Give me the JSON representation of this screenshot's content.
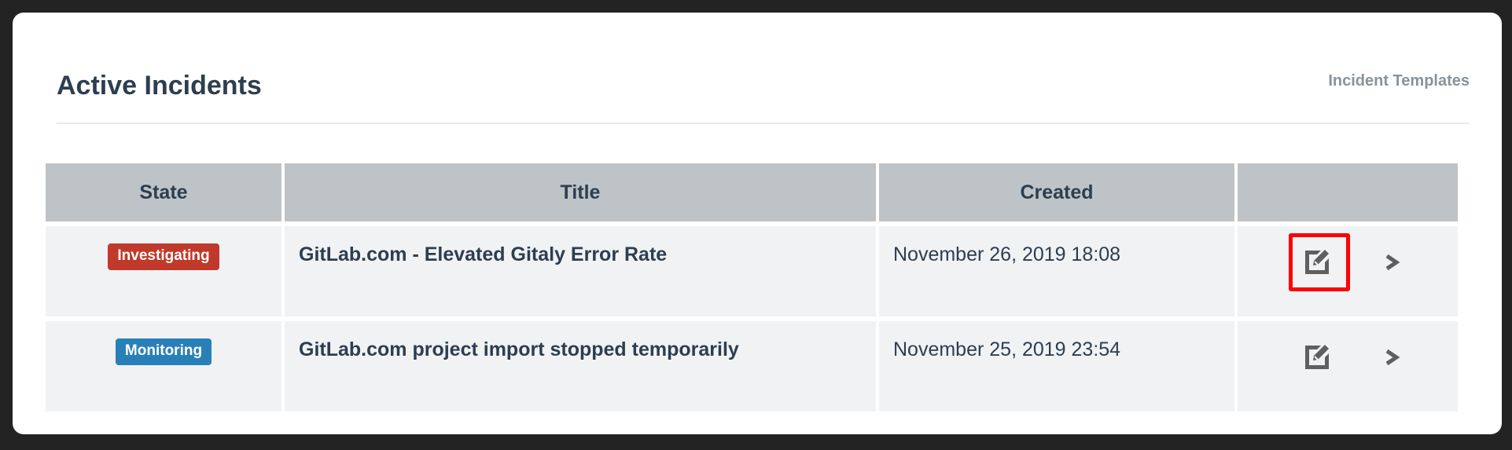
{
  "header": {
    "title": "Active Incidents",
    "templates_link": "Incident Templates"
  },
  "table": {
    "columns": [
      "State",
      "Title",
      "Created",
      ""
    ],
    "rows": [
      {
        "state": "Investigating",
        "state_color": "#c0392b",
        "title": "GitLab.com - Elevated Gitaly Error Rate",
        "created": "November 26, 2019 18:08"
      },
      {
        "state": "Monitoring",
        "state_color": "#2980b9",
        "title": "GitLab.com project import stopped temporarily",
        "created": "November 25, 2019 23:54"
      }
    ]
  }
}
